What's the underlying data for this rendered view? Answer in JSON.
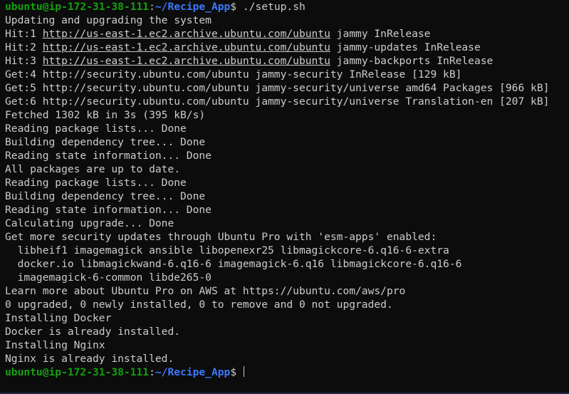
{
  "prompt": {
    "user_host": "ubuntu@ip-172-31-38-111",
    "sep": ":",
    "path": "~/Recipe_App",
    "symbol": "$"
  },
  "command": " ./setup.sh",
  "output": {
    "l01": "Updating and upgrading the system",
    "l02a": "Hit:1 ",
    "l02b": "http://us-east-1.ec2.archive.ubuntu.com/ubuntu",
    "l02c": " jammy InRelease",
    "l03a": "Hit:2 ",
    "l03b": "http://us-east-1.ec2.archive.ubuntu.com/ubuntu",
    "l03c": " jammy-updates InRelease",
    "l04a": "Hit:3 ",
    "l04b": "http://us-east-1.ec2.archive.ubuntu.com/ubuntu",
    "l04c": " jammy-backports InRelease",
    "l05": "Get:4 http://security.ubuntu.com/ubuntu jammy-security InRelease [129 kB]",
    "l06": "Get:5 http://security.ubuntu.com/ubuntu jammy-security/universe amd64 Packages [966 kB]",
    "l07": "Get:6 http://security.ubuntu.com/ubuntu jammy-security/universe Translation-en [207 kB]",
    "l08": "Fetched 1302 kB in 3s (395 kB/s)",
    "l09": "Reading package lists... Done",
    "l10": "Building dependency tree... Done",
    "l11": "Reading state information... Done",
    "l12": "All packages are up to date.",
    "l13": "Reading package lists... Done",
    "l14": "Building dependency tree... Done",
    "l15": "Reading state information... Done",
    "l16": "Calculating upgrade... Done",
    "l17": "Get more security updates through Ubuntu Pro with 'esm-apps' enabled:",
    "l18": "  libheif1 imagemagick ansible libopenexr25 libmagickcore-6.q16-6-extra",
    "l19": "  docker.io libmagickwand-6.q16-6 imagemagick-6.q16 libmagickcore-6.q16-6",
    "l20": "  imagemagick-6-common libde265-0",
    "l21": "Learn more about Ubuntu Pro on AWS at https://ubuntu.com/aws/pro",
    "l22": "0 upgraded, 0 newly installed, 0 to remove and 0 not upgraded.",
    "l23": "Installing Docker",
    "l24": "Docker is already installed.",
    "l25": "Installing Nginx",
    "l26": "Nginx is already installed."
  },
  "colors": {
    "background": "#0c0c0c",
    "text": "#cccccc",
    "prompt_user": "#13a10e",
    "prompt_path": "#3b78ff"
  }
}
